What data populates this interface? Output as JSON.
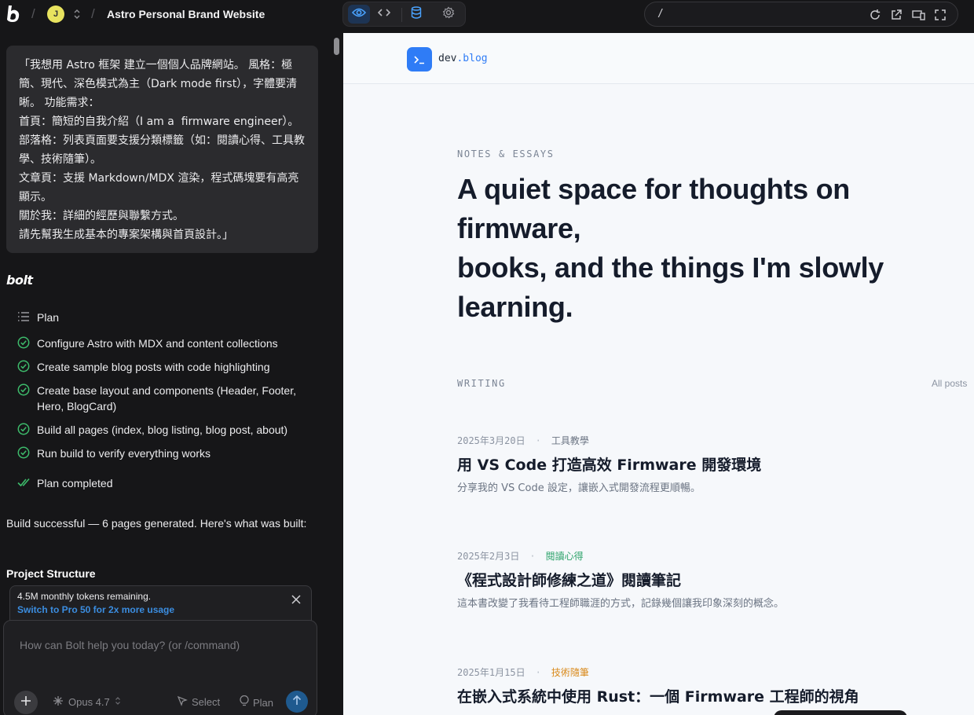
{
  "topbar": {
    "avatar_initial": "J",
    "project_title": "Astro Personal Brand Website",
    "url_path": "/"
  },
  "chat": {
    "user_prompt": "「我想用 Astro 框架 建立一個個人品牌網站。 風格：極\n簡、現代、深色模式為主（Dark mode first），字體要清\n晰。 功能需求：\n首頁：簡短的自我介紹（I am a  firmware engineer）。\n部落格：列表頁面要支援分類標籤（如：閱讀心得、工具教\n學、技術隨筆）。\n文章頁：支援 Markdown/MDX 渲染，程式碼塊要有高亮\n顯示。\n關於我：詳細的經歷與聯繫方式。\n請先幫我生成基本的專案架構與首頁設計。」",
    "assistant_name": "bolt",
    "plan_label": "Plan",
    "plan_steps": [
      "Configure Astro with MDX and content collections",
      "Create sample blog posts with code highlighting",
      "Create base layout and components (Header, Footer, Hero, BlogCard)",
      "Build all pages (index, blog listing, blog post, about)",
      "Run build to verify everything works"
    ],
    "plan_completed": "Plan completed",
    "summary": "Build successful — 6 pages generated. Here's what was built:",
    "section_heading": "Project Structure"
  },
  "token_notice": {
    "remaining": "4.5M monthly tokens remaining.",
    "upgrade_link": "Switch to Pro 50 for 2x more usage"
  },
  "composer": {
    "placeholder": "How can Bolt help you today? (or /command)",
    "model": "Opus 4.7",
    "select_label": "Select",
    "plan_label": "Plan"
  },
  "preview": {
    "logo_prefix": "dev",
    "logo_suffix": ".blog",
    "kicker": "NOTES & ESSAYS",
    "hero": "A quiet space for thoughts on firmware,\nbooks, and the things I'm slowly learning.",
    "section_label": "WRITING",
    "all_posts": "All posts",
    "posts": [
      {
        "date": "2025年3月20日",
        "tag": "工具教學",
        "tag_color": "#6b7483",
        "title": "用 VS Code 打造高效 Firmware 開發環境",
        "desc": "分享我的 VS Code 設定，讓嵌入式開發流程更順暢。"
      },
      {
        "date": "2025年2月3日",
        "tag": "閱讀心得",
        "tag_color": "#2ea36b",
        "title": "《程式設計師修練之道》閱讀筆記",
        "desc": "這本書改變了我看待工程師職涯的方式，記錄幾個讓我印象深刻的概念。"
      },
      {
        "date": "2025年1月15日",
        "tag": "技術隨筆",
        "tag_color": "#d98a1c",
        "title": "在嵌入式系統中使用 Rust：一個 Firmware 工程師的視角",
        "desc": ""
      }
    ]
  }
}
